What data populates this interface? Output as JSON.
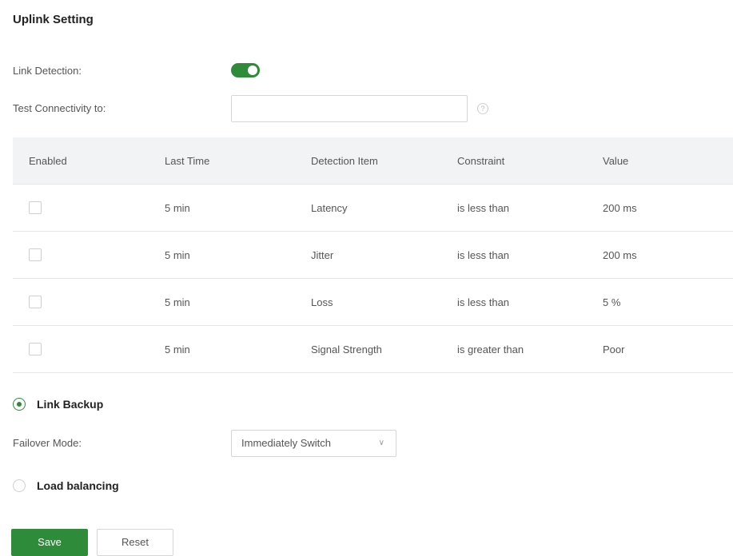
{
  "page": {
    "title": "Uplink Setting"
  },
  "link_detection": {
    "label": "Link Detection:",
    "enabled": true
  },
  "test_connectivity": {
    "label": "Test Connectivity to:",
    "value": "",
    "placeholder": ""
  },
  "table": {
    "headers": [
      "Enabled",
      "Last Time",
      "Detection Item",
      "Constraint",
      "Value"
    ],
    "rows": [
      {
        "enabled": false,
        "last_time": "5 min",
        "item": "Latency",
        "constraint": "is less than",
        "value": "200 ms"
      },
      {
        "enabled": false,
        "last_time": "5 min",
        "item": "Jitter",
        "constraint": "is less than",
        "value": "200 ms"
      },
      {
        "enabled": false,
        "last_time": "5 min",
        "item": "Loss",
        "constraint": "is less than",
        "value": "5 %"
      },
      {
        "enabled": false,
        "last_time": "5 min",
        "item": "Signal Strength",
        "constraint": "is greater than",
        "value": "Poor"
      }
    ]
  },
  "mode": {
    "link_backup_label": "Link Backup",
    "link_backup_selected": true,
    "failover_label": "Failover Mode:",
    "failover_value": "Immediately Switch",
    "load_balancing_label": "Load balancing",
    "load_balancing_selected": false
  },
  "actions": {
    "save_label": "Save",
    "reset_label": "Reset"
  },
  "colors": {
    "accent": "#2e8b3a",
    "header_bg": "#f2f3f5",
    "border": "#d6d6d6"
  },
  "icons": {
    "info": "info-circle-icon",
    "select_chevron": "chevron-down-icon",
    "toggle": "toggle-switch"
  }
}
